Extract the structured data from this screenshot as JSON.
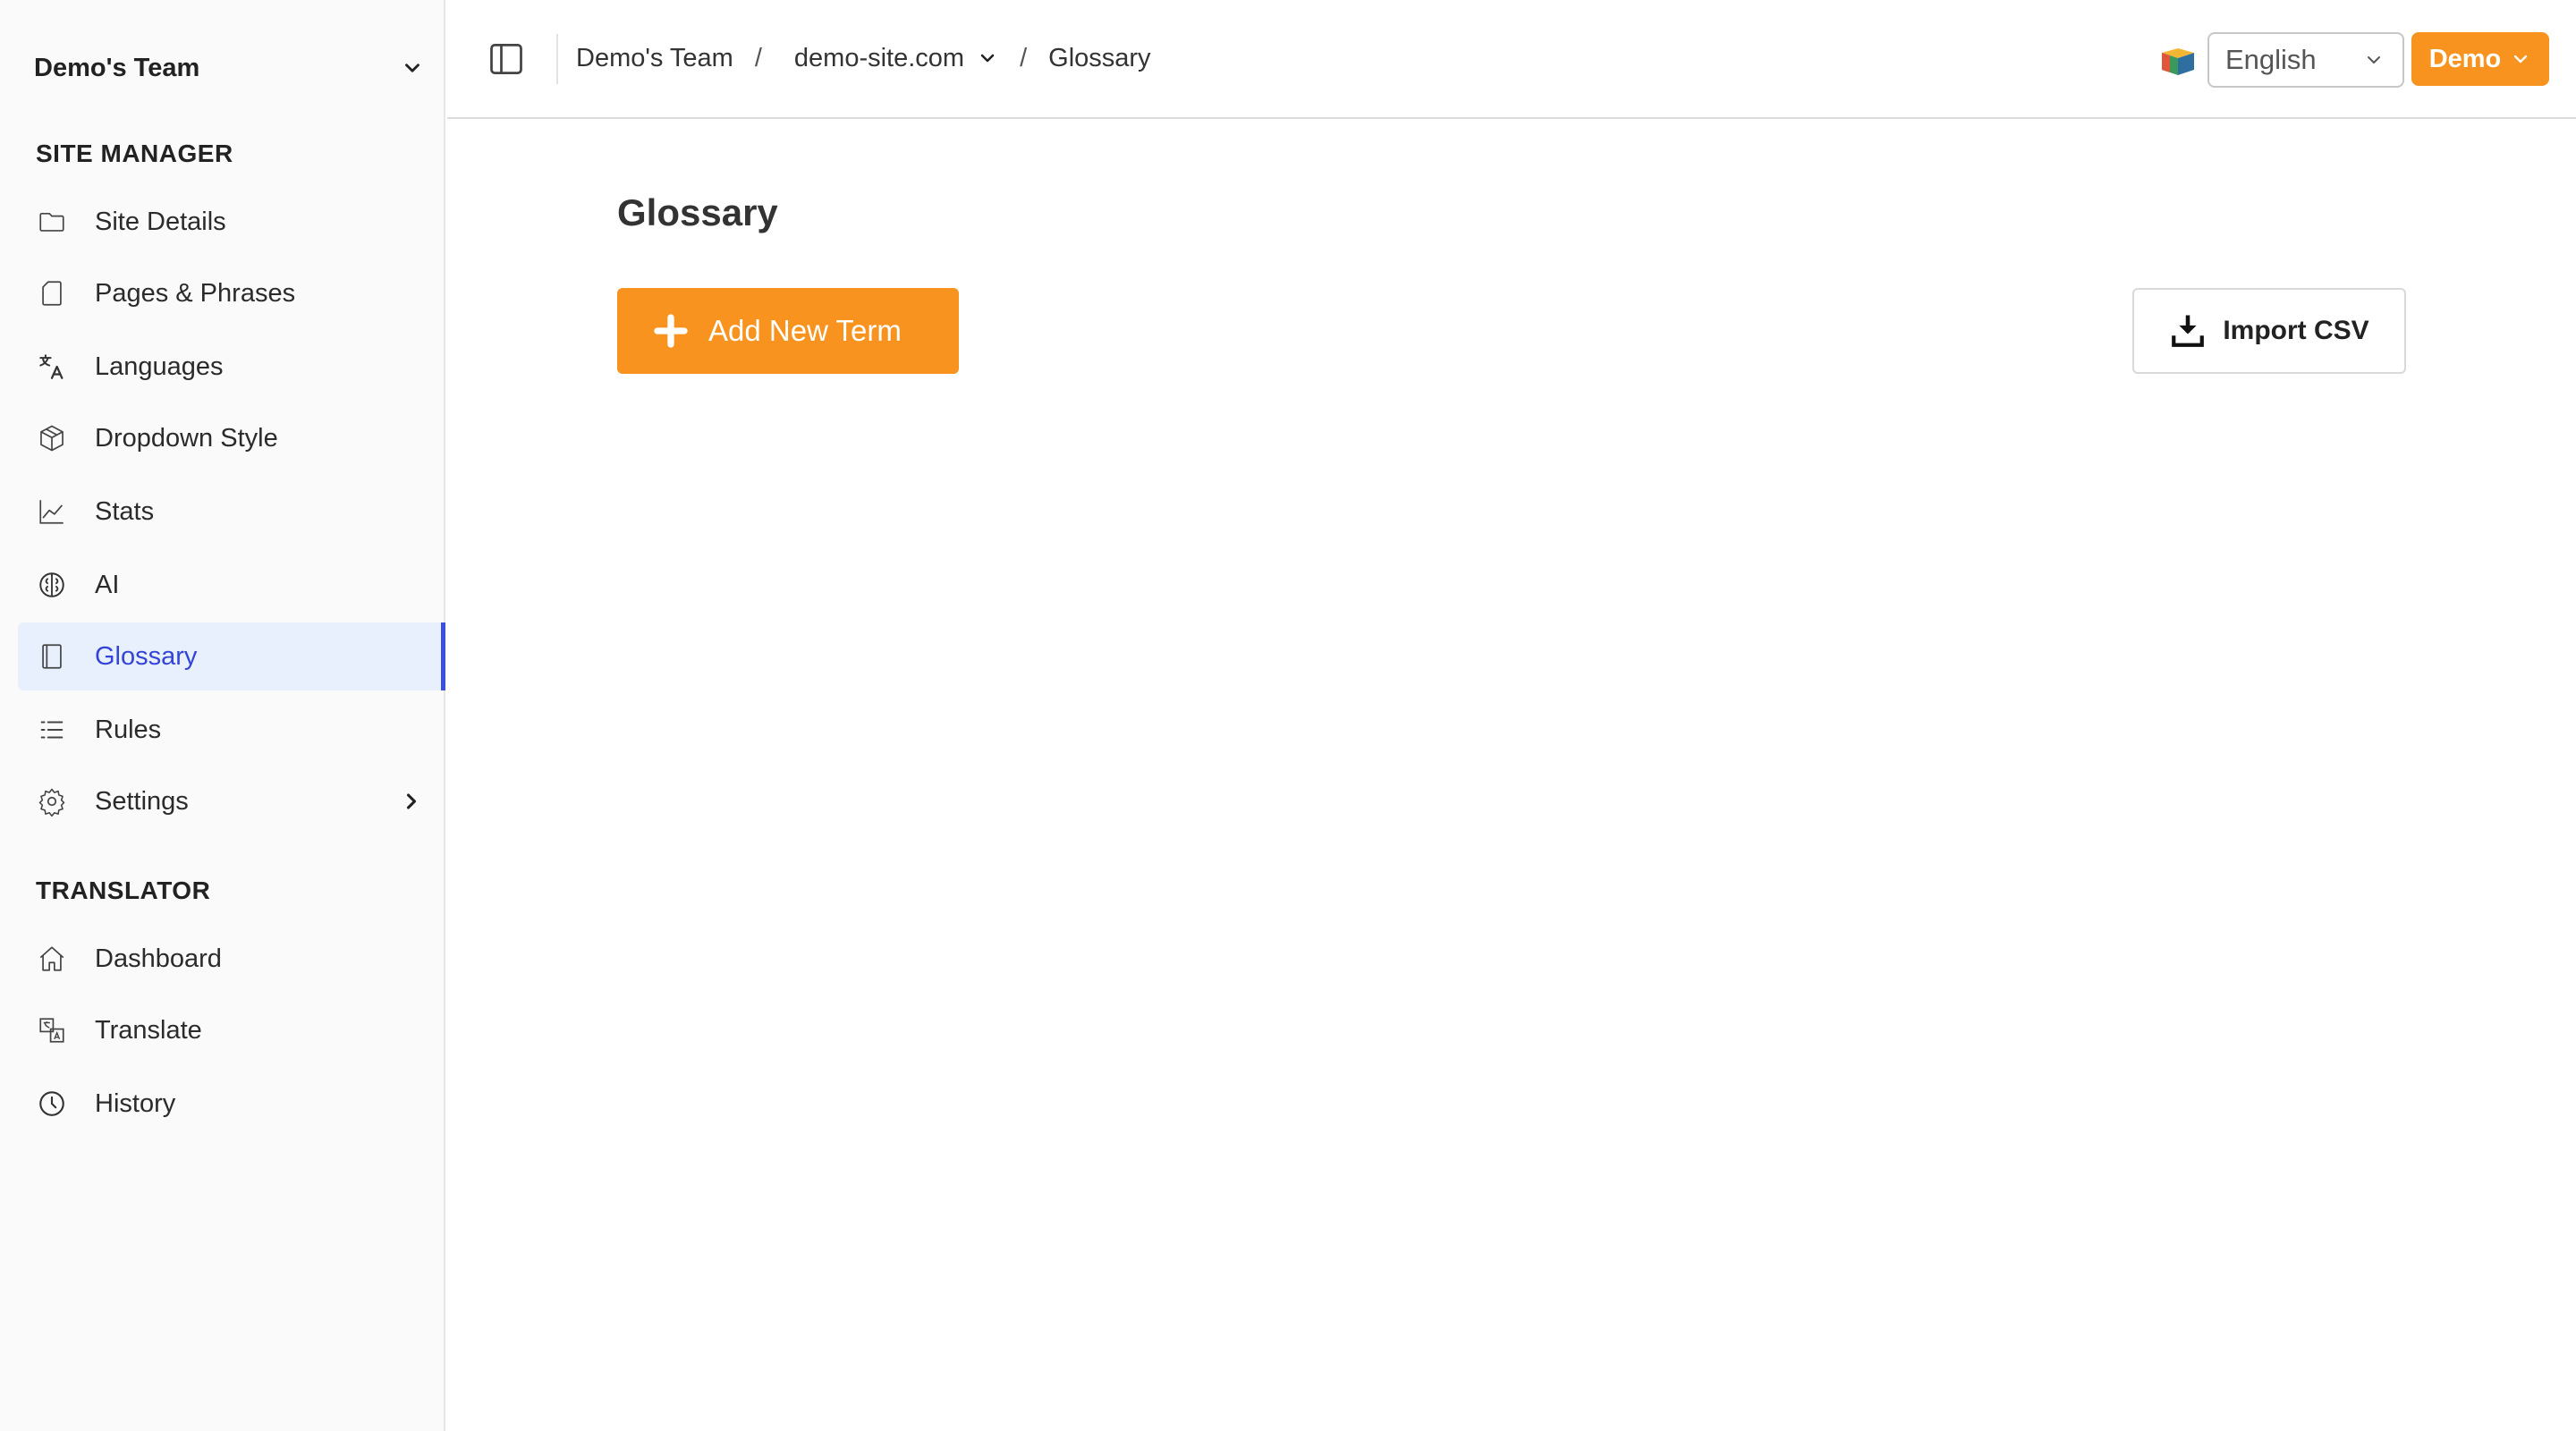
{
  "sidebar": {
    "team_name": "Demo's Team",
    "sections": {
      "site_manager": "SITE MANAGER",
      "translator": "TRANSLATOR"
    },
    "items": [
      {
        "label": "Site Details",
        "icon": "folder-icon",
        "active": false
      },
      {
        "label": "Pages & Phrases",
        "icon": "page-icon",
        "active": false
      },
      {
        "label": "Languages",
        "icon": "translate-icon",
        "active": false
      },
      {
        "label": "Dropdown Style",
        "icon": "cube-icon",
        "active": false
      },
      {
        "label": "Stats",
        "icon": "line-chart-icon",
        "active": false
      },
      {
        "label": "AI",
        "icon": "brain-icon",
        "active": false
      },
      {
        "label": "Glossary",
        "icon": "book-icon",
        "active": true
      },
      {
        "label": "Rules",
        "icon": "list-icon",
        "active": false
      },
      {
        "label": "Settings",
        "icon": "gear-icon",
        "active": false
      },
      {
        "label": "Dashboard",
        "icon": "home-icon",
        "active": false
      },
      {
        "label": "Translate",
        "icon": "translate-box-icon",
        "active": false
      },
      {
        "label": "History",
        "icon": "clock-icon",
        "active": false
      }
    ]
  },
  "header": {
    "breadcrumb": {
      "team": "Demo's Team",
      "site": "demo-site.com",
      "current": "Glossary",
      "separator": "/"
    },
    "language": {
      "selected": "English"
    },
    "account_label": "Demo"
  },
  "main": {
    "title": "Glossary",
    "add_button_label": "Add New Term",
    "import_button_label": "Import CSV"
  },
  "colors": {
    "accent": "#f7931e",
    "active_nav_bg": "#e9f0fd",
    "active_nav_text": "#3344d6",
    "active_nav_indicator": "#3a4fe0"
  }
}
